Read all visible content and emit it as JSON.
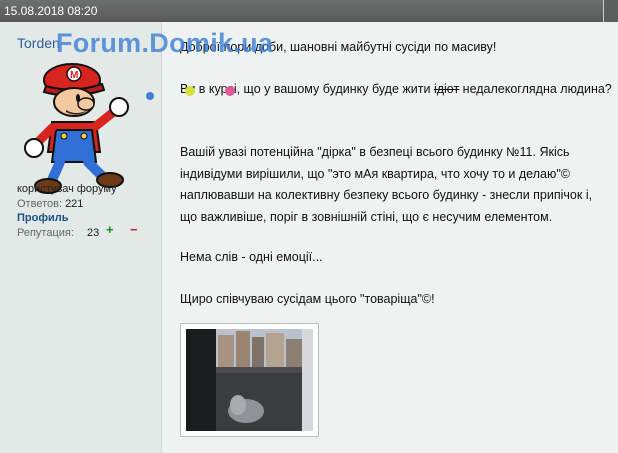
{
  "header": {
    "timestamp": "15.08.2018 08:20"
  },
  "user": {
    "name": "Torden",
    "watermark": "Forum.Domik.ua",
    "role": "користувач форуму",
    "posts_label": "Ответов:",
    "posts_count": "221",
    "profile_label": "Профиль",
    "reputation_label": "Репутация:",
    "reputation_value": "23",
    "rep_plus": "+",
    "rep_minus": "−"
  },
  "post": {
    "line1": "Доброї пори доби, шановні майбутні сусіди по масиву!",
    "para2_before": "Ви в курсі, що у вашому будинку буде жити ",
    "para2_strike": "ідіот",
    "para2_after": " недалекоглядна людина?",
    "para3": "Вашій увазі потенційна \"дірка\" в безпеці всього будинку №11. Якісь індивідуми вирішили, що \"это мАя квартира, что хочу то и делаю\"© наплювавши на колективну безпеку всього будинку - знесли припічок і, що важливіше, поріг в зовнішній стіні, що є несучим елементом.",
    "para4": "Нема слів - одні емоції...",
    "para5": "Щиро співчуваю сусідам цього \"товаріща\"©!"
  }
}
